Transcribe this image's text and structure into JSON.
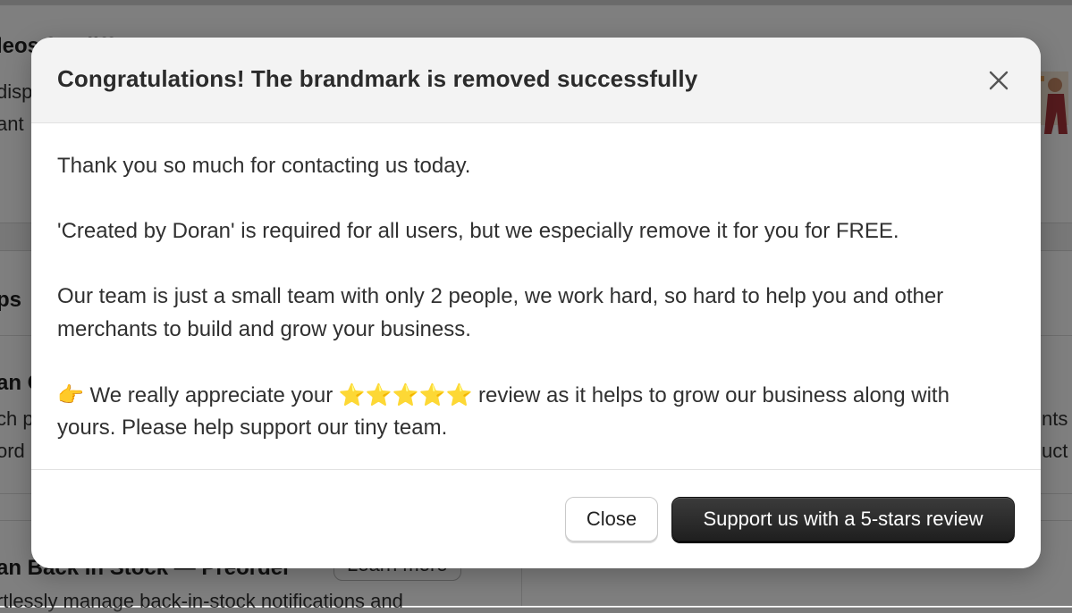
{
  "background": {
    "heading_1": "leos for different",
    "text_1a": "disp",
    "text_1b": "ant",
    "heading_2": "ps",
    "app_1_name": "an C",
    "app_1_line1": "ch p",
    "app_1_line2": "ord",
    "right_text_1": "nts t",
    "right_text_2": "uct",
    "app_2_name": "an Back In Stock — Preorder",
    "app_2_desc": "rtlessly manage back-in-stock notifications and",
    "learn_more_label": "Learn more"
  },
  "modal": {
    "title": "Congratulations! The brandmark is removed successfully",
    "close_icon": "close-icon",
    "paragraphs": {
      "p1": "Thank you so much for contacting us today.",
      "p2": "'Created by Doran' is required for all users, but we especially remove it for you for FREE.",
      "p3_line1": "Our team is just a small team with only 2 people, we work hard, so hard to help you and other",
      "p3_line2": "merchants to build and grow your business.",
      "p4_pointer": "👉",
      "p4_before": " We really appreciate your ",
      "p4_stars": "⭐⭐⭐⭐⭐",
      "p4_after": " review as it helps to grow our business along with",
      "p4_line2": "yours. Please help support our tiny team."
    },
    "footer": {
      "close_label": "Close",
      "review_label": "Support us with a 5-stars review"
    }
  },
  "colors": {
    "primary_button": "#2a2a2a",
    "star": "#f2b01e",
    "overlay": "rgba(0,0,0,0.5)"
  }
}
